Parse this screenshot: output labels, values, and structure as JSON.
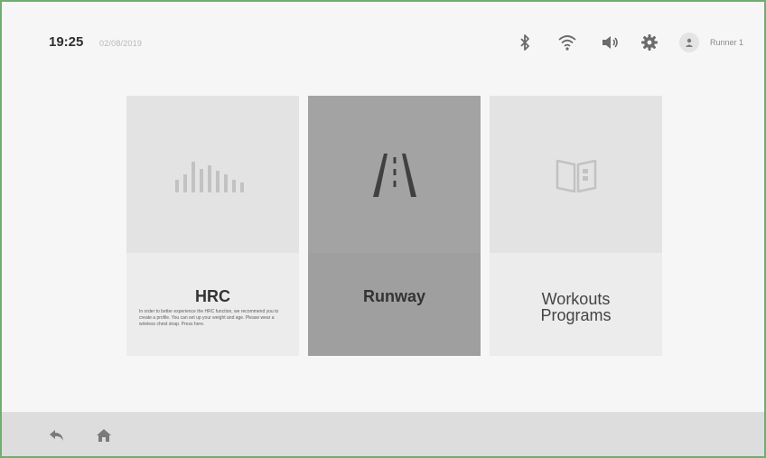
{
  "status_bar": {
    "time": "19:25",
    "date": "02/08/2019",
    "icons": [
      "bluetooth-icon",
      "wifi-icon",
      "volume-icon",
      "settings-icon"
    ],
    "user_name": "Runner 1"
  },
  "cards": [
    {
      "id": "hrc",
      "title": "HRC",
      "icon": "bar-chart-icon",
      "description": "In order to better experience the HRC function, we recommend you to create a profile. You can set up your weight and age. Please wear a wireless chest strap. Press here."
    },
    {
      "id": "runway",
      "title": "Runway",
      "icon": "road-icon",
      "selected": true
    },
    {
      "id": "workouts",
      "title_line1": "Workouts",
      "title_line2": "Programs",
      "icon": "book-icon"
    }
  ],
  "bottom_nav": {
    "icons": [
      "back-icon",
      "home-icon"
    ]
  },
  "colors": {
    "frame_border": "#6fae6f",
    "selected_card": "#9f9f9f",
    "card_background": "#e3e3e3",
    "bottom_bar": "#dddddd"
  }
}
